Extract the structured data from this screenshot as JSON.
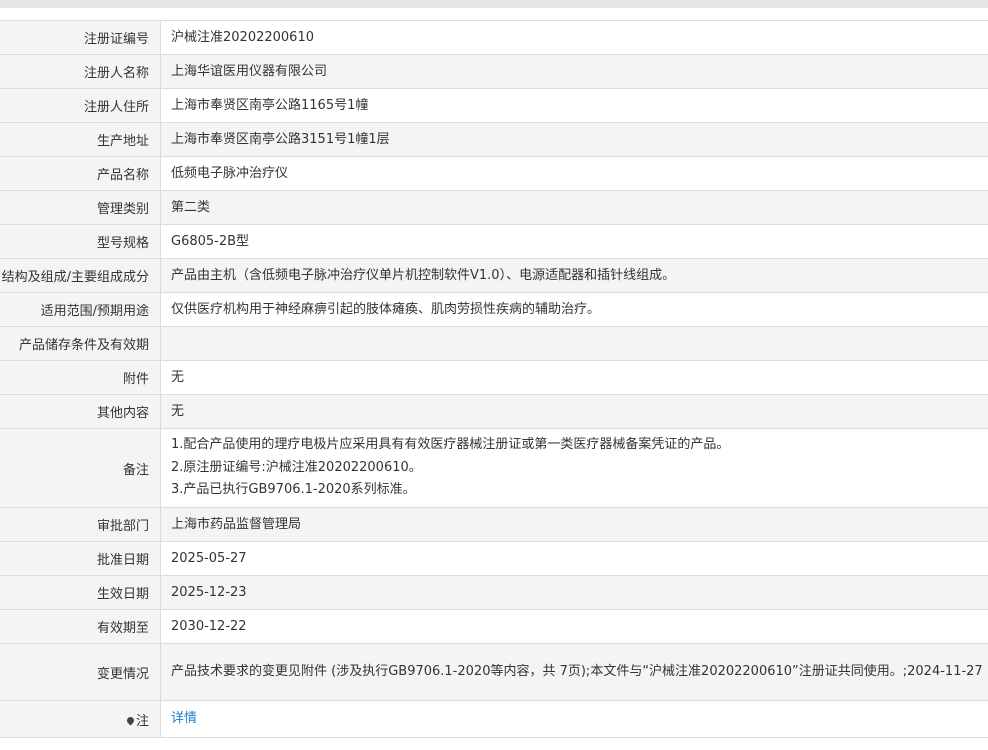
{
  "rows": [
    {
      "label": "注册证编号",
      "value": "沪械注准20202200610"
    },
    {
      "label": "注册人名称",
      "value": "上海华谊医用仪器有限公司"
    },
    {
      "label": "注册人住所",
      "value": "上海市奉贤区南亭公路1165号1幢"
    },
    {
      "label": "生产地址",
      "value": "上海市奉贤区南亭公路3151号1幢1层"
    },
    {
      "label": "产品名称",
      "value": "低频电子脉冲治疗仪"
    },
    {
      "label": "管理类别",
      "value": "第二类"
    },
    {
      "label": "型号规格",
      "value": "G6805-2B型"
    },
    {
      "label": "结构及组成/主要组成成分",
      "value": "产品由主机（含低频电子脉冲治疗仪单片机控制软件V1.0）、电源适配器和插针线组成。"
    },
    {
      "label": "适用范围/预期用途",
      "value": "仅供医疗机构用于神经麻痹引起的肢体瘫痪、肌肉劳损性疾病的辅助治疗。"
    },
    {
      "label": "产品储存条件及有效期",
      "value": ""
    },
    {
      "label": "附件",
      "value": "无"
    },
    {
      "label": "其他内容",
      "value": "无"
    }
  ],
  "remarks": {
    "label": "备注",
    "lines": [
      "1.配合产品使用的理疗电极片应采用具有有效医疗器械注册证或第一类医疗器械备案凭证的产品。",
      "2.原注册证编号:沪械注准20202200610。",
      "3.产品已执行GB9706.1-2020系列标准。"
    ]
  },
  "rows2": [
    {
      "label": "审批部门",
      "value": "上海市药品监督管理局"
    },
    {
      "label": "批准日期",
      "value": "2025-05-27"
    },
    {
      "label": "生效日期",
      "value": "2025-12-23"
    },
    {
      "label": "有效期至",
      "value": "2030-12-22"
    }
  ],
  "change": {
    "label": "变更情况",
    "value": "产品技术要求的变更见附件 (涉及执行GB9706.1-2020等内容，共 7页);本文件与“沪械注准20202200610”注册证共同使用。;2024-11-27"
  },
  "note": {
    "label": "注",
    "link_text": "详情",
    "icon": "pin-icon"
  },
  "colors": {
    "label_bg": "#f4f4f4",
    "border": "#dcdcdc",
    "link": "#1e7ec8"
  }
}
